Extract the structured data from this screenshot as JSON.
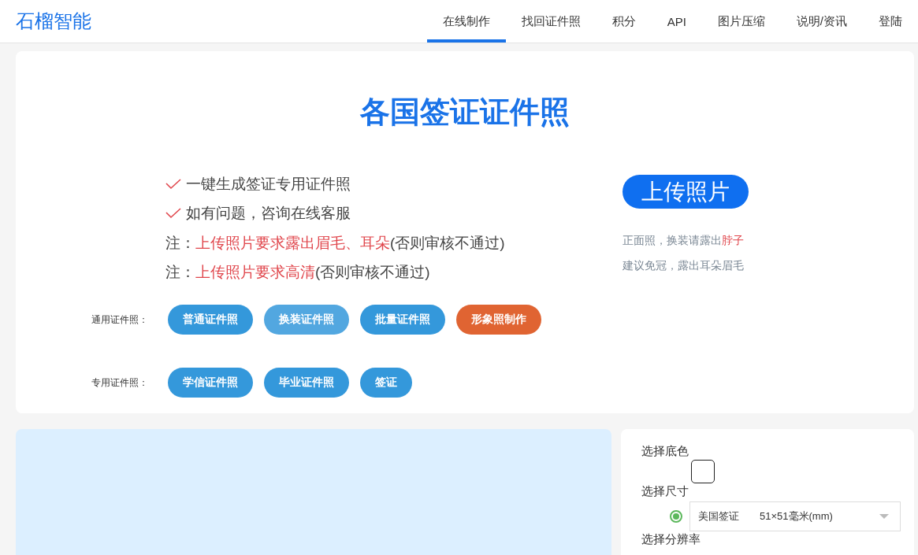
{
  "header": {
    "logo": "石榴智能",
    "nav": [
      {
        "label": "在线制作",
        "selected": true
      },
      {
        "label": "找回证件照",
        "selected": false
      },
      {
        "label": "积分",
        "selected": false
      },
      {
        "label": "API",
        "selected": false
      },
      {
        "label": "图片压缩",
        "selected": false
      },
      {
        "label": "说明/资讯",
        "selected": false
      },
      {
        "label": "登陆",
        "selected": false
      }
    ]
  },
  "intro": {
    "title": "各国签证证件照",
    "features": [
      "一键生成签证专用证件照",
      "如有问题，咨询在线客服"
    ],
    "notes": [
      {
        "prefix": "注：",
        "highlight": "上传照片要求露出眉毛、耳朵",
        "suffix": "(否则审核不通过)"
      },
      {
        "prefix": "注：",
        "highlight": "上传照片要求高清",
        "suffix": "(否则审核不通过)"
      }
    ],
    "upload_button": "上传照片",
    "hints": [
      {
        "text": "正面照，换装请露出",
        "highlight": "脖子"
      },
      {
        "text": "建议免冠，露出耳朵眉毛"
      }
    ],
    "groups": [
      {
        "label": "通用证件照：",
        "buttons": [
          {
            "label": "普通证件照",
            "color": "#3498db"
          },
          {
            "label": "换装证件照",
            "color": "#52a7e0"
          },
          {
            "label": "批量证件照",
            "color": "#3498db"
          },
          {
            "label": "形象照制作",
            "color": "#e06432"
          }
        ]
      },
      {
        "label": "专用证件照：",
        "buttons": [
          {
            "label": "学信证件照",
            "color": "#3498db"
          },
          {
            "label": "毕业证件照",
            "color": "#3498db"
          },
          {
            "label": "签证",
            "color": "#3498db"
          }
        ]
      }
    ]
  },
  "settings": {
    "background_label": "选择底色",
    "swatches": [
      {
        "color": "#ffffff",
        "selected": true
      }
    ],
    "size_label": "选择尺寸",
    "size_option": {
      "selected": true,
      "name": "美国签证",
      "size": "51×51毫米(mm)"
    },
    "resolution_label": "选择分辨率"
  }
}
